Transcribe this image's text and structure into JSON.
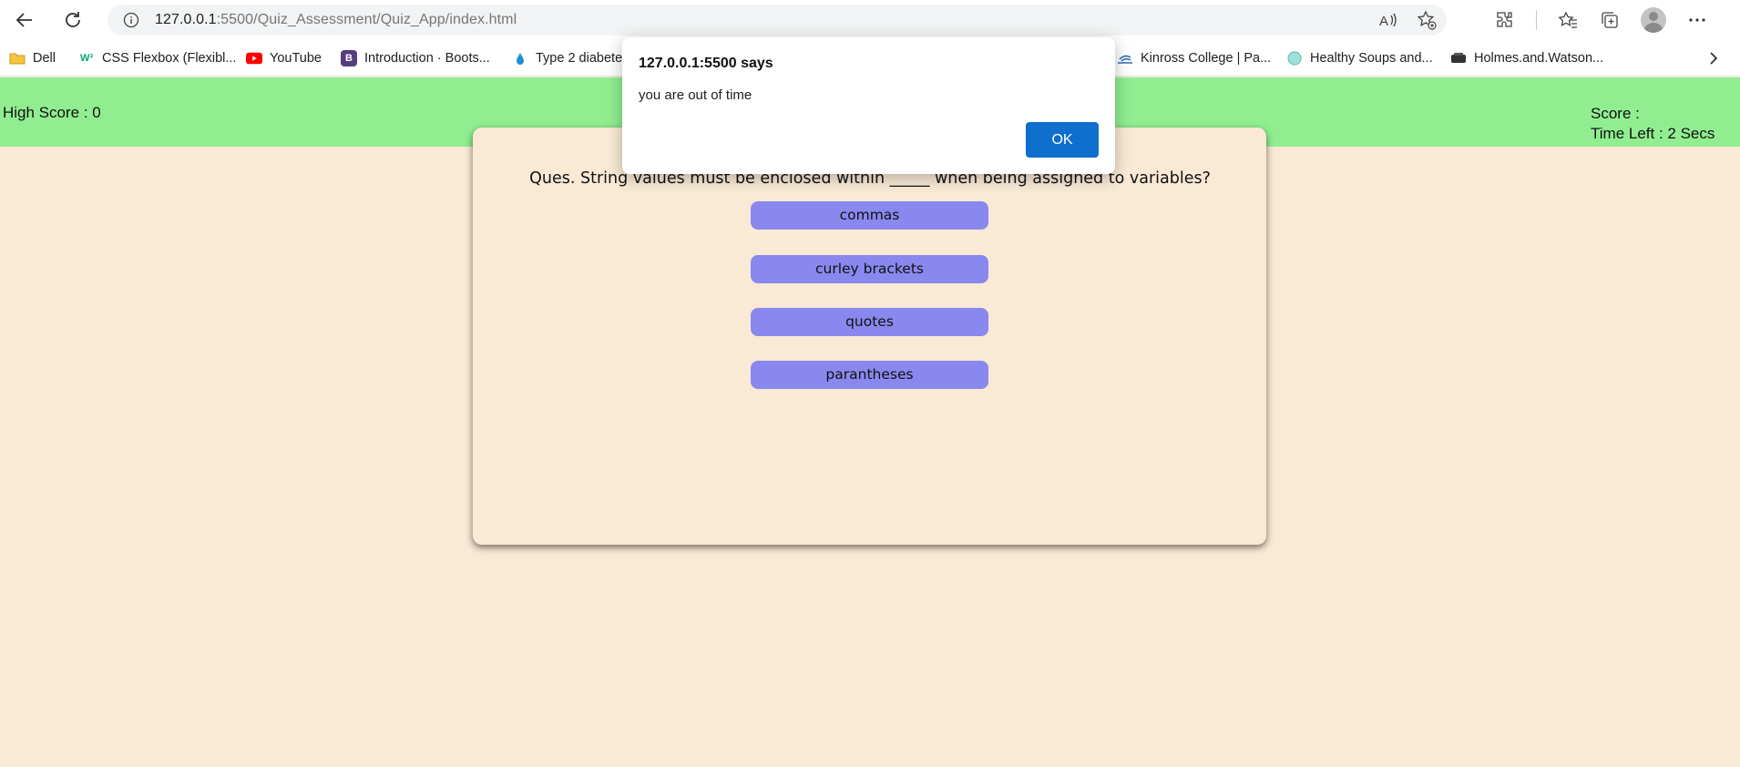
{
  "browser": {
    "url_host": "127.0.0.1",
    "url_rest": ":5500/Quiz_Assessment/Quiz_App/index.html"
  },
  "bookmarks": [
    {
      "label": "Dell",
      "icon": "folder-icon"
    },
    {
      "label": "CSS Flexbox (Flexibl...",
      "icon": "w3schools-icon"
    },
    {
      "label": "YouTube",
      "icon": "youtube-icon"
    },
    {
      "label": "Introduction · Boots...",
      "icon": "bootstrap-icon"
    },
    {
      "label": "Type 2 diabete",
      "icon": "site-icon"
    },
    {
      "label": "Kinross College | Pa...",
      "icon": "site-icon"
    },
    {
      "label": "Healthy Soups and...",
      "icon": "site-icon"
    },
    {
      "label": "Holmes.and.Watson...",
      "icon": "site-icon"
    }
  ],
  "header": {
    "high_score": "High Score : 0",
    "score": "Score :",
    "time_left": "Time Left : 2 Secs"
  },
  "quiz": {
    "question": "Ques. String values must be enclosed within _____ when being assigned to variables?",
    "answers": [
      "commas",
      "curley brackets",
      "quotes",
      "parantheses"
    ]
  },
  "alert": {
    "title": "127.0.0.1:5500 says",
    "message": "you are out of time",
    "ok_label": "OK"
  },
  "colors": {
    "header_bg": "#90ee90",
    "page_bg": "#f9e9d5",
    "answer_bg": "#8888ee",
    "ok_button": "#0f6fcf"
  }
}
